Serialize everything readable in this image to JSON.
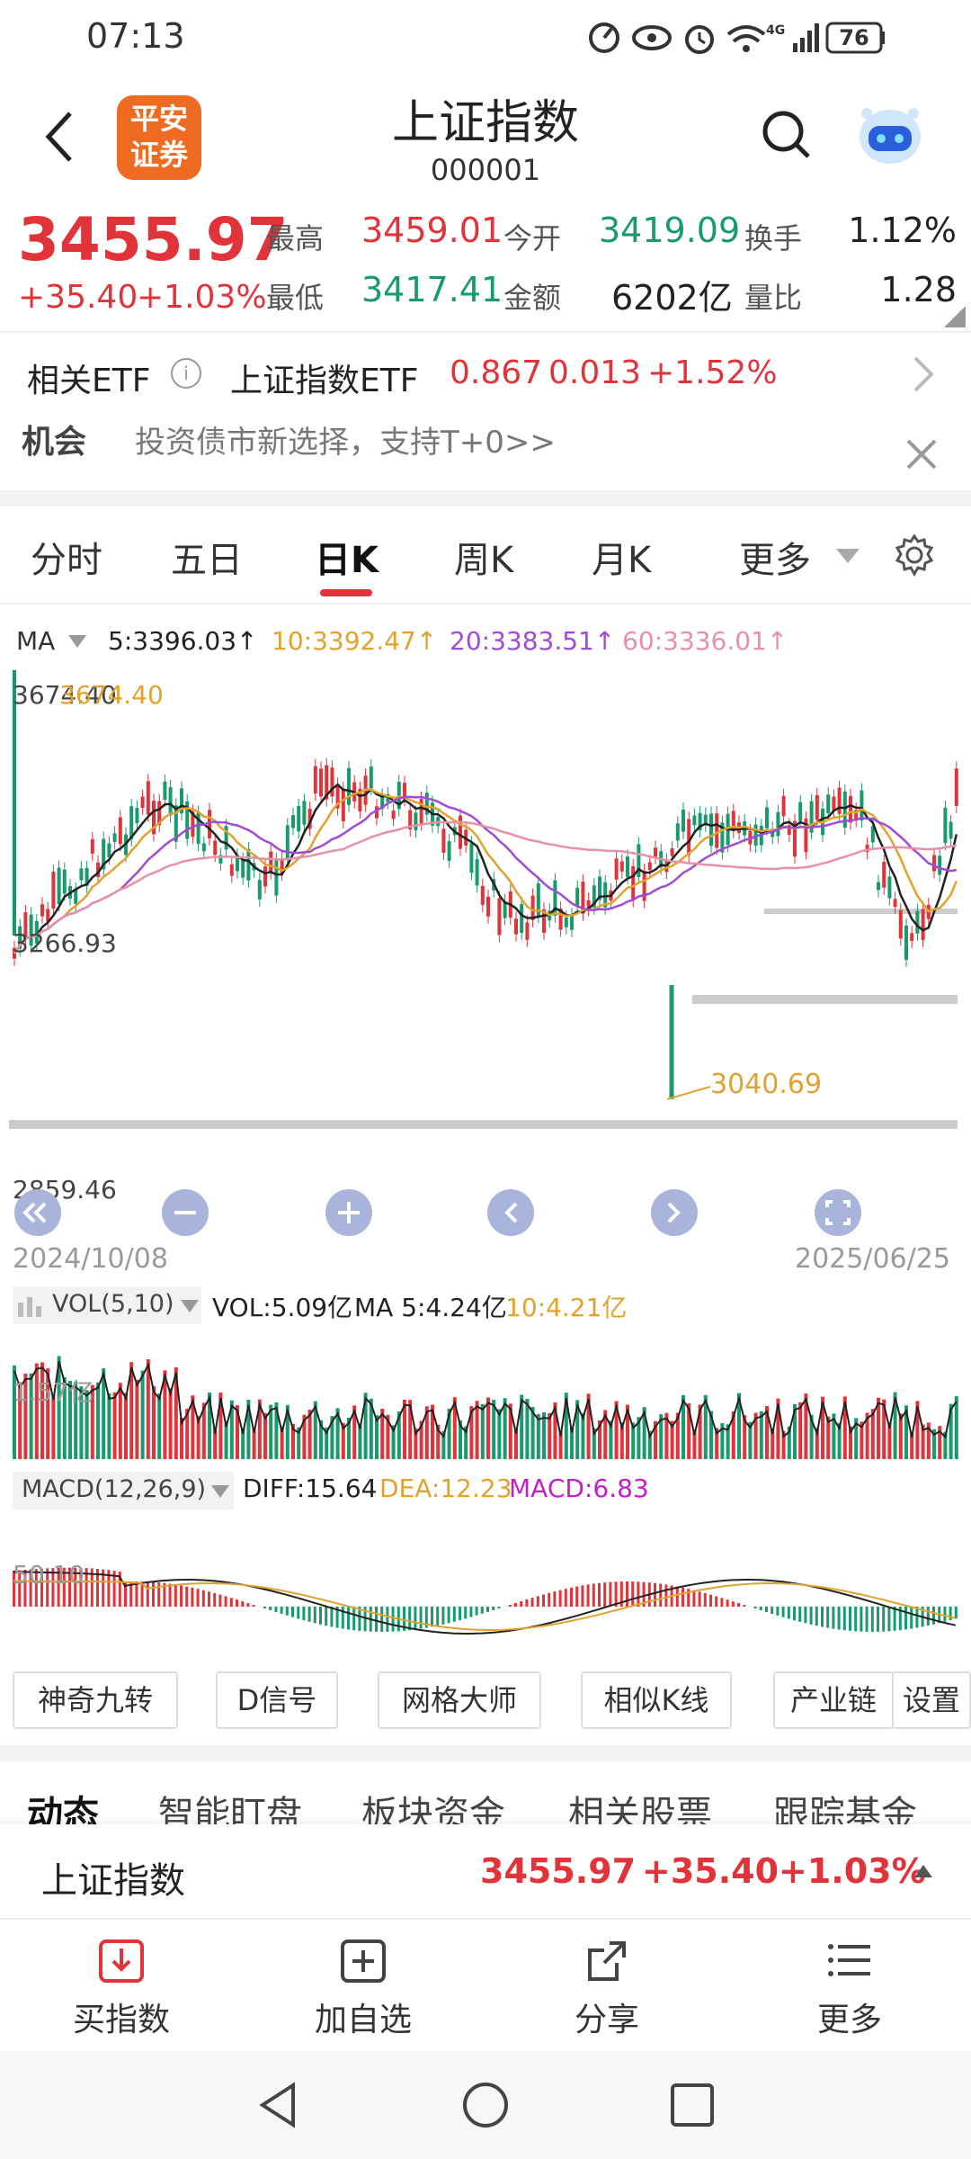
{
  "status": {
    "time": "07:13",
    "battery": "76",
    "signal": "4G"
  },
  "header": {
    "title": "上证指数",
    "code": "000001",
    "logo_line1": "平安",
    "logo_line2": "证券"
  },
  "quote": {
    "price": "3455.97",
    "change": "+35.40",
    "change_pct": "+1.03%",
    "high_label": "最高",
    "high": "3459.01",
    "open_label": "今开",
    "open": "3419.09",
    "turnover_label": "换手",
    "turnover": "1.12%",
    "low_label": "最低",
    "low": "3417.41",
    "amount_label": "金额",
    "amount": "6202亿",
    "volratio_label": "量比",
    "volratio": "1.28"
  },
  "etf": {
    "label": "相关ETF",
    "name": "上证指数ETF",
    "price": "0.867",
    "change": "0.013",
    "pct": "+1.52%"
  },
  "promo": {
    "label": "机会",
    "text": "投资债市新选择，支持T+0>>"
  },
  "tabs": [
    "分时",
    "五日",
    "日K",
    "周K",
    "月K",
    "更多"
  ],
  "active_tab": 2,
  "ma": {
    "label": "MA",
    "ma5": "5:3396.03↑",
    "ma10": "10:3392.47↑",
    "ma20": "20:3383.51↑",
    "ma60": "60:3336.01↑"
  },
  "kline": {
    "high_label": "3674.40",
    "high_label_left": "3674.40",
    "mid_label": "3266.93",
    "low_label": "2859.46",
    "min_point": "3040.69",
    "date_start": "2024/10/08",
    "date_end": "2025/06/25"
  },
  "vol": {
    "label": "VOL(5,10)",
    "vol": "VOL:5.09亿",
    "ma5": "MA 5:4.24亿",
    "ma10": "10:4.21亿",
    "axis": "1.57亿"
  },
  "macd": {
    "label": "MACD(12,26,9)",
    "diff": "DIFF:15.64",
    "dea": "DEA:12.23",
    "macd": "MACD:6.83",
    "axis": "50.10"
  },
  "tools": [
    "神奇九转",
    "D信号",
    "网格大师",
    "相似K线",
    "产业链",
    "设置"
  ],
  "subtabs": [
    "动态",
    "智能盯盘",
    "板块资金",
    "相关股票",
    "跟踪基金"
  ],
  "bottom_quote": {
    "name": "上证指数",
    "price": "3455.97",
    "change": "+35.40",
    "pct": "+1.03%"
  },
  "bottom_nav": [
    "买指数",
    "加自选",
    "分享",
    "更多"
  ],
  "colors": {
    "up": "#e0333a",
    "down": "#1a9a6c",
    "ma5": "#222222",
    "ma10": "#e3a22e",
    "ma20": "#a14bd4",
    "ma60": "#e691a8"
  }
}
